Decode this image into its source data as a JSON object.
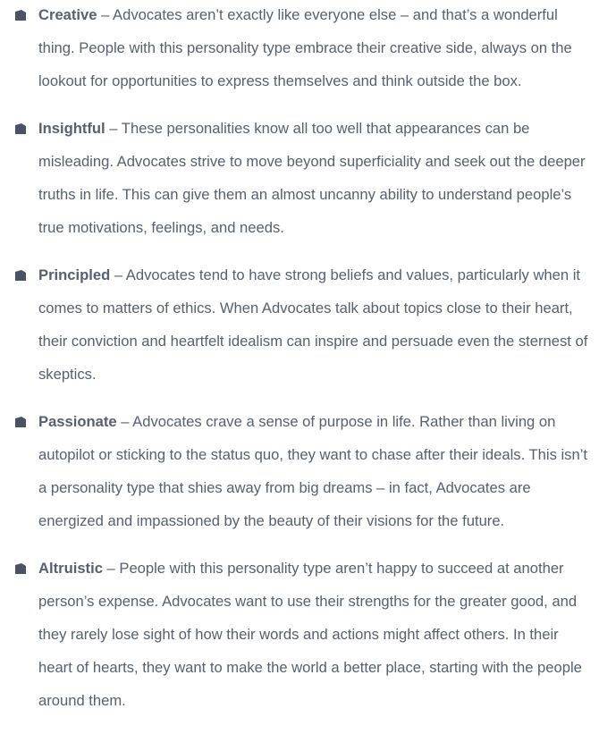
{
  "items": [
    {
      "term": "Creative",
      "description": " – Advocates aren’t exactly like everyone else – and that’s a wonderful thing. People with this personality type embrace their creative side, always on the lookout for opportunities to express themselves and think outside the box."
    },
    {
      "term": "Insightful",
      "description": " – These personalities know all too well that appearances can be misleading. Advocates strive to move beyond superficiality and seek out the deeper truths in life. This can give them an almost uncanny ability to understand people’s true motivations, feelings, and needs."
    },
    {
      "term": "Principled",
      "description": " – Advocates tend to have strong beliefs and values, particularly when it comes to matters of ethics. When Advocates talk about topics close to their heart, their conviction and heartfelt idealism can inspire and persuade even the sternest of skeptics."
    },
    {
      "term": "Passionate",
      "description": " – Advocates crave a sense of purpose in life. Rather than living on autopilot or sticking to the status quo, they want to chase after their ideals. This isn’t a personality type that shies away from big dreams – in fact, Advocates are energized and impassioned by the beauty of their visions for the future."
    },
    {
      "term": "Altruistic",
      "description": " – People with this personality type aren’t happy to succeed at another person’s expense. Advocates want to use their strengths for the greater good, and they rarely lose sight of how their words and actions might affect others. In their heart of hearts, they want to make the world a better place, starting with the people around them."
    }
  ],
  "colors": {
    "text": "#576071",
    "bullet": "#4a5264"
  },
  "bullet_icon": "pentagon-bullet-icon"
}
